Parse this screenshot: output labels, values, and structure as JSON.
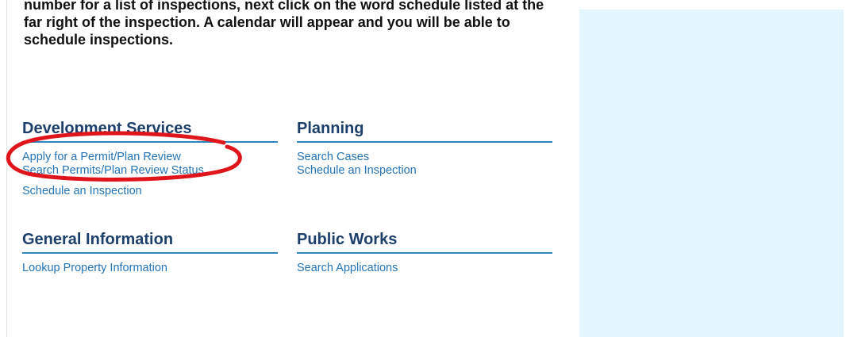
{
  "intro": {
    "lines": [
      "number for a list of inspections, next click on the word schedule listed at the",
      "far right of the inspection.  A calendar will appear and you will be able to",
      "schedule inspections."
    ]
  },
  "sections": [
    {
      "title": "Development Services",
      "links": [
        "Apply for a Permit/Plan Review",
        "Search Permits/Plan Review Status",
        "Schedule an Inspection"
      ]
    },
    {
      "title": "Planning",
      "links": [
        "Search Cases",
        "Schedule an Inspection"
      ]
    },
    {
      "title": "General Information",
      "links": [
        "Lookup Property Information"
      ]
    },
    {
      "title": "Public Works",
      "links": [
        "Search Applications"
      ]
    }
  ],
  "colors": {
    "heading": "#1c3f6b",
    "link": "#2474b7",
    "rule": "#2e86c1",
    "side_panel": "#e3f5fd",
    "annotation": "#e0151b"
  }
}
